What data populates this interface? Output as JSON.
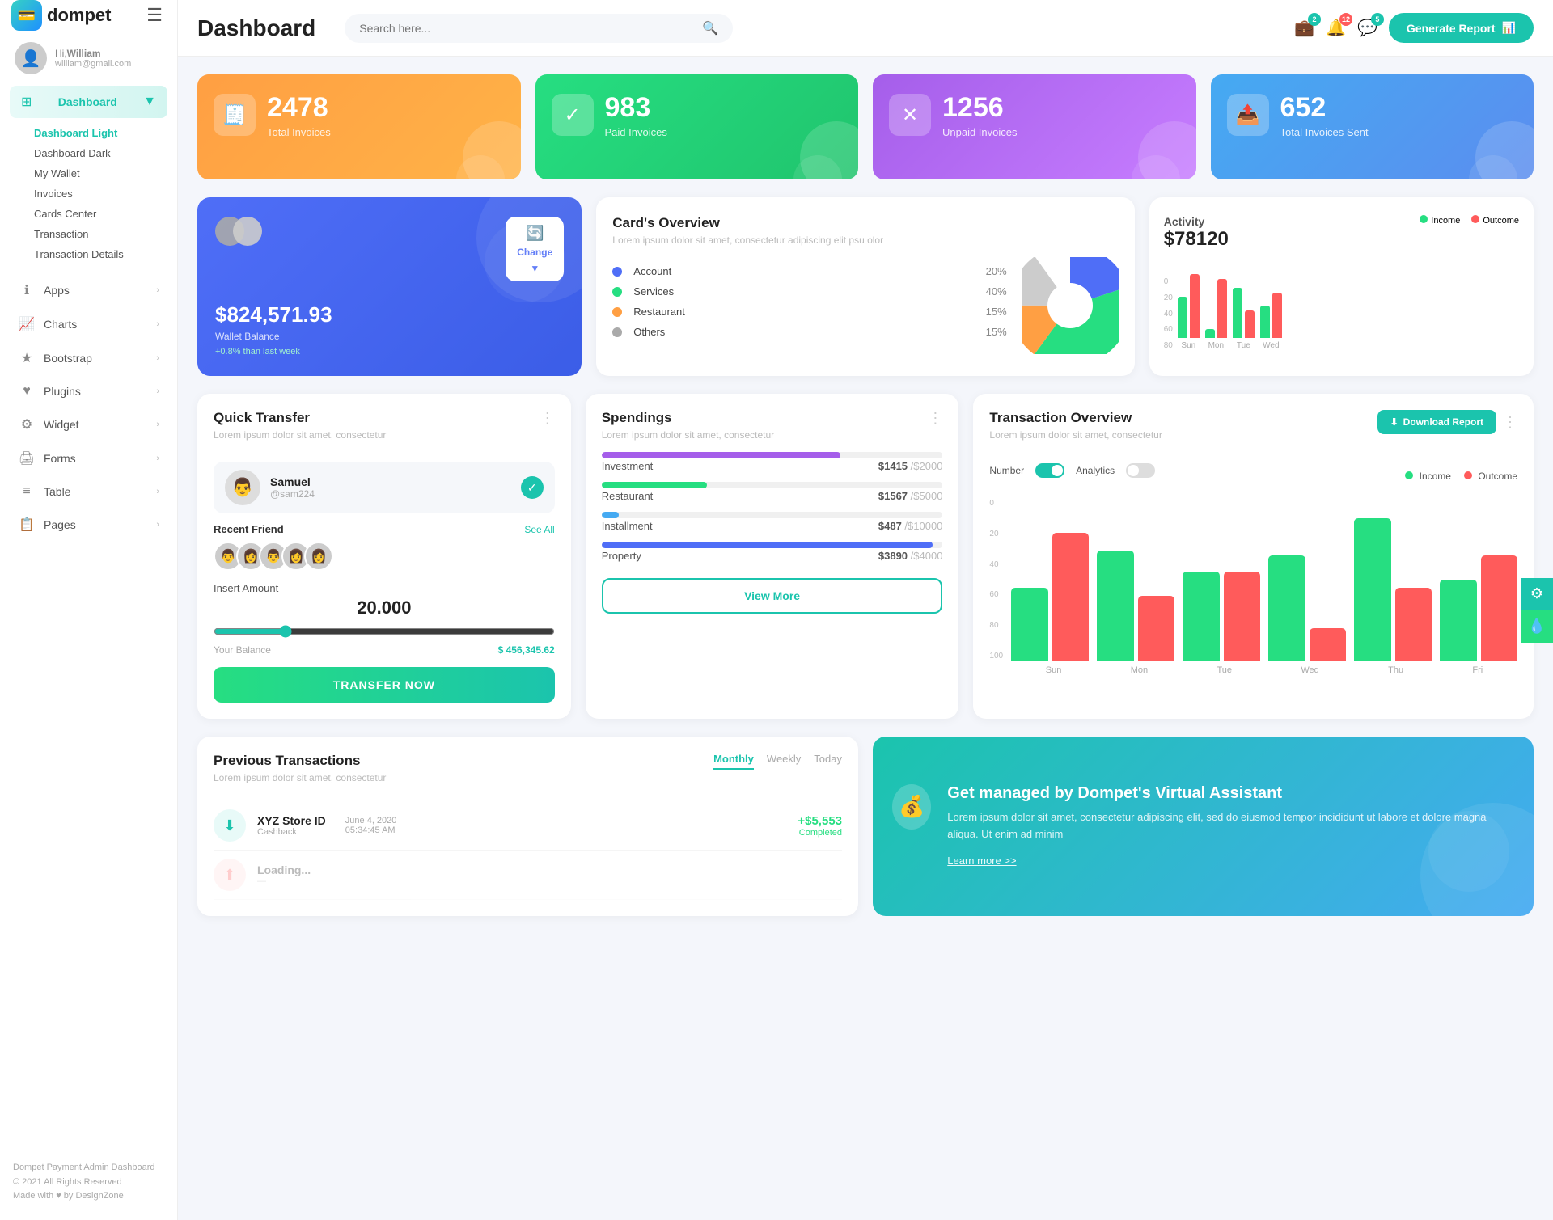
{
  "sidebar": {
    "logo_text": "dompet",
    "user": {
      "greeting": "Hi,",
      "name": "William",
      "email": "william@gmail.com"
    },
    "nav": {
      "dashboard_label": "Dashboard",
      "dashboard_items": [
        {
          "label": "Dashboard Light",
          "active": true
        },
        {
          "label": "Dashboard Dark",
          "active": false
        },
        {
          "label": "My Wallet",
          "active": false
        },
        {
          "label": "Invoices",
          "active": false
        },
        {
          "label": "Cards Center",
          "active": false
        },
        {
          "label": "Transaction",
          "active": false
        },
        {
          "label": "Transaction Details",
          "active": false
        }
      ],
      "sections": [
        {
          "icon": "ℹ",
          "label": "Apps"
        },
        {
          "icon": "📊",
          "label": "Charts"
        },
        {
          "icon": "★",
          "label": "Bootstrap"
        },
        {
          "icon": "♥",
          "label": "Plugins"
        },
        {
          "icon": "⚙",
          "label": "Widget"
        },
        {
          "icon": "🖨",
          "label": "Forms"
        },
        {
          "icon": "≡",
          "label": "Table"
        },
        {
          "icon": "📋",
          "label": "Pages"
        }
      ]
    },
    "footer": {
      "line1": "Dompet Payment Admin Dashboard",
      "line2": "© 2021 All Rights Reserved",
      "line3": "Made with ♥ by DesignZone"
    }
  },
  "topbar": {
    "title": "Dashboard",
    "search_placeholder": "Search here...",
    "notifications_count": "2",
    "alerts_count": "12",
    "messages_count": "5",
    "generate_btn": "Generate Report"
  },
  "stat_cards": [
    {
      "color": "orange",
      "icon": "🧾",
      "number": "2478",
      "label": "Total Invoices"
    },
    {
      "color": "green",
      "icon": "✓",
      "number": "983",
      "label": "Paid Invoices"
    },
    {
      "color": "purple",
      "icon": "✕",
      "number": "1256",
      "label": "Unpaid Invoices"
    },
    {
      "color": "teal",
      "icon": "📤",
      "number": "652",
      "label": "Total Invoices Sent"
    }
  ],
  "wallet": {
    "amount": "$824,571.93",
    "label": "Wallet Balance",
    "change": "+0.8% than last week",
    "change_btn": "Change"
  },
  "cards_overview": {
    "title": "Card's Overview",
    "subtitle": "Lorem ipsum dolor sit amet, consectetur adipiscing elit psu olor",
    "items": [
      {
        "color": "#4f6ef7",
        "label": "Account",
        "pct": "20%"
      },
      {
        "color": "#26de81",
        "label": "Services",
        "pct": "40%"
      },
      {
        "color": "#ff9f43",
        "label": "Restaurant",
        "pct": "15%"
      },
      {
        "color": "#aaa",
        "label": "Others",
        "pct": "15%"
      }
    ]
  },
  "activity": {
    "title": "Activity",
    "amount": "$78120",
    "income_label": "Income",
    "outcome_label": "Outcome",
    "bars": [
      {
        "day": "Sun",
        "income": 45,
        "outcome": 70
      },
      {
        "day": "Mon",
        "income": 10,
        "outcome": 65
      },
      {
        "day": "Tue",
        "income": 55,
        "outcome": 30
      },
      {
        "day": "Wed",
        "income": 35,
        "outcome": 50
      }
    ],
    "y_labels": [
      "0",
      "20",
      "40",
      "60",
      "80"
    ]
  },
  "quick_transfer": {
    "title": "Quick Transfer",
    "subtitle": "Lorem ipsum dolor sit amet, consectetur",
    "selected_user": {
      "name": "Samuel",
      "handle": "@sam224"
    },
    "recent_label": "Recent Friend",
    "see_all": "See All",
    "friends_count": 5,
    "insert_amount_label": "Insert Amount",
    "amount": "20.000",
    "balance_label": "Your Balance",
    "balance_value": "$ 456,345.62",
    "transfer_btn": "TRANSFER NOW"
  },
  "spendings": {
    "title": "Spendings",
    "subtitle": "Lorem ipsum dolor sit amet, consectetur",
    "items": [
      {
        "label": "Investment",
        "amount": "$1415",
        "max": "$2000",
        "pct": 70,
        "color": "#a55eea"
      },
      {
        "label": "Restaurant",
        "amount": "$1567",
        "max": "$5000",
        "pct": 31,
        "color": "#26de81"
      },
      {
        "label": "Installment",
        "amount": "$487",
        "max": "$10000",
        "pct": 5,
        "color": "#45aaf2"
      },
      {
        "label": "Property",
        "amount": "$3890",
        "max": "$4000",
        "pct": 97,
        "color": "#4f6ef7"
      }
    ],
    "view_more_btn": "View More"
  },
  "transaction_overview": {
    "title": "Transaction Overview",
    "subtitle": "Lorem ipsum dolor sit amet, consectetur",
    "download_btn": "Download Report",
    "toggle1_label": "Number",
    "toggle2_label": "Analytics",
    "income_label": "Income",
    "outcome_label": "Outcome",
    "bars": [
      {
        "day": "Sun",
        "income": 45,
        "outcome": 79
      },
      {
        "day": "Mon",
        "income": 68,
        "outcome": 40
      },
      {
        "day": "Tue",
        "income": 55,
        "outcome": 55
      },
      {
        "day": "Wed",
        "income": 65,
        "outcome": 20
      },
      {
        "day": "Thu",
        "income": 88,
        "outcome": 45
      },
      {
        "day": "Fri",
        "income": 50,
        "outcome": 65
      }
    ],
    "y_labels": [
      "0",
      "20",
      "40",
      "60",
      "80",
      "100"
    ]
  },
  "prev_transactions": {
    "title": "Previous Transactions",
    "subtitle": "Lorem ipsum dolor sit amet, consectetur",
    "tabs": [
      "Monthly",
      "Weekly",
      "Today"
    ],
    "active_tab": "Monthly",
    "items": [
      {
        "name": "XYZ Store ID",
        "type": "Cashback",
        "date": "June 4, 2020",
        "time": "05:34:45 AM",
        "amount": "+$5,553",
        "status": "Completed"
      }
    ]
  },
  "virtual_assistant": {
    "title": "Get managed by Dompet's Virtual Assistant",
    "subtitle": "Lorem ipsum dolor sit amet, consectetur adipiscing elit, sed do eiusmod tempor incididunt ut labore et dolore magna aliqua. Ut enim ad minim",
    "link": "Learn more >>"
  }
}
